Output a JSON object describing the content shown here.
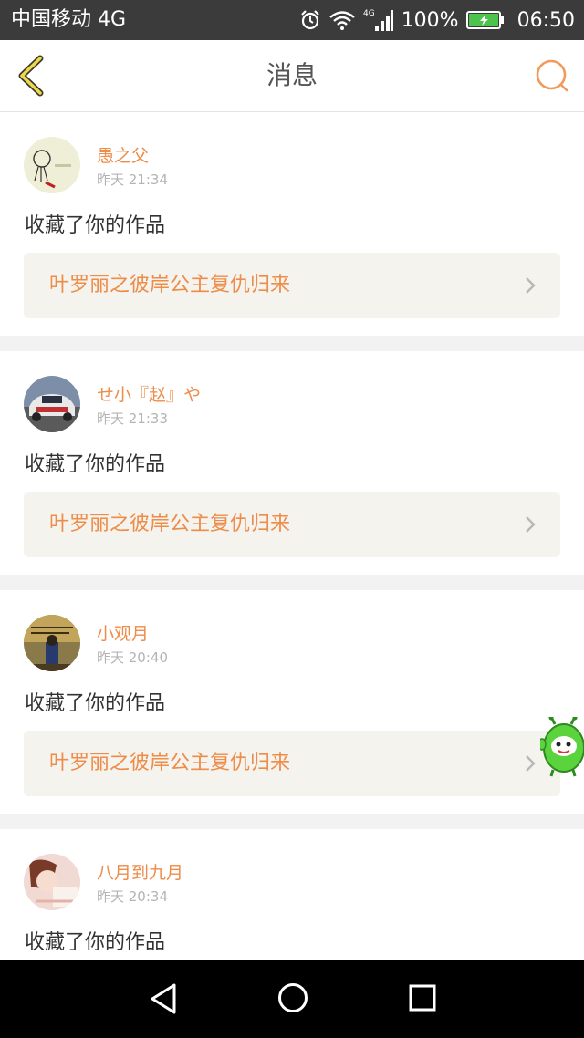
{
  "status_bar": {
    "carrier": "中国移动 4G",
    "signal_badge": "4G",
    "battery": "100%",
    "time": "06:50"
  },
  "header": {
    "title": "消息",
    "back_icon": "back-chevron-icon",
    "search_icon": "search-icon",
    "accent_color": "#ee8c4a"
  },
  "messages": [
    {
      "username": "愚之父",
      "time": "昨天 21:34",
      "action": "收藏了你的作品",
      "work_title": "叶罗丽之彼岸公主复仇归来"
    },
    {
      "username": "せ小『赵』や",
      "time": "昨天 21:33",
      "action": "收藏了你的作品",
      "work_title": "叶罗丽之彼岸公主复仇归来"
    },
    {
      "username": "小观月",
      "time": "昨天 20:40",
      "action": "收藏了你的作品",
      "work_title": "叶罗丽之彼岸公主复仇归来"
    },
    {
      "username": "八月到九月",
      "time": "昨天 20:34",
      "action": "收藏了你的作品",
      "work_title": ""
    }
  ],
  "nav_bar": {
    "back_icon": "nav-back-triangle-icon",
    "home_icon": "nav-home-circle-icon",
    "recent_icon": "nav-recent-square-icon"
  }
}
